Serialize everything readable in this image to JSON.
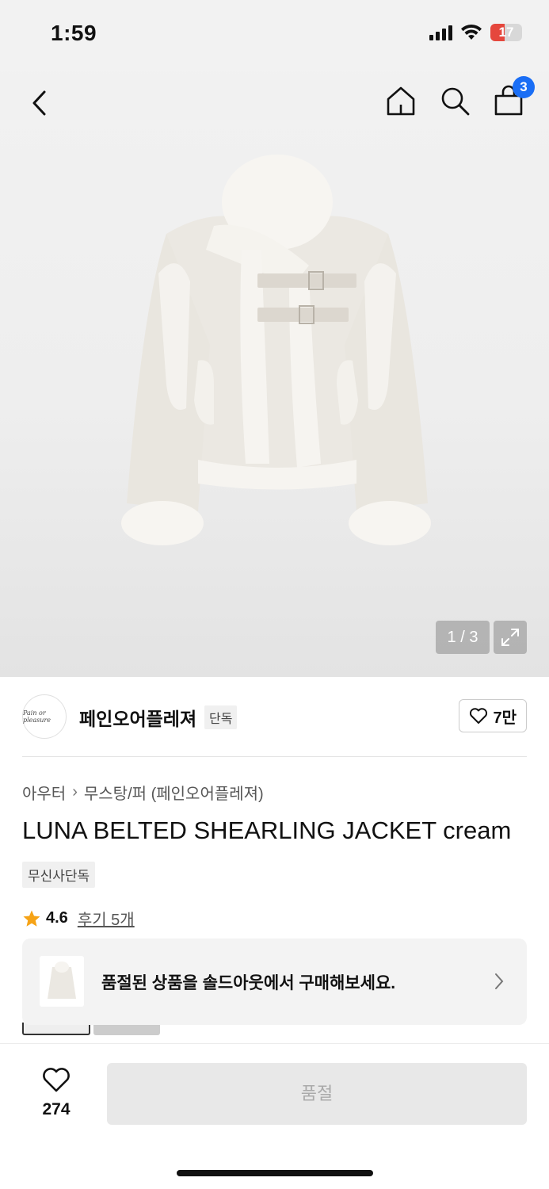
{
  "status_bar": {
    "time": "1:59",
    "battery": "17"
  },
  "nav": {
    "cart_count": "3"
  },
  "gallery": {
    "pager": "1 / 3"
  },
  "brand": {
    "logo_text": "Pain or pleasure",
    "name": "페인오어플레져",
    "tag": "단독",
    "likes": "7만"
  },
  "breadcrumb": {
    "category": "아우터",
    "subcategory": "무스탕/퍼 (페인오어플레져)"
  },
  "product": {
    "title": "LUNA BELTED SHEARLING JACKET cream",
    "badge": "무신사단독",
    "rating": "4.6",
    "reviews": "후기 5개"
  },
  "soldout_banner": {
    "message": "품절된 상품을 솔드아웃에서 구매해보세요."
  },
  "bottom_bar": {
    "wish_count": "274",
    "buy_label": "품절"
  },
  "colors": {
    "accent": "#1a6ef5",
    "star": "#f6a316",
    "battery_low": "#e5473d"
  }
}
